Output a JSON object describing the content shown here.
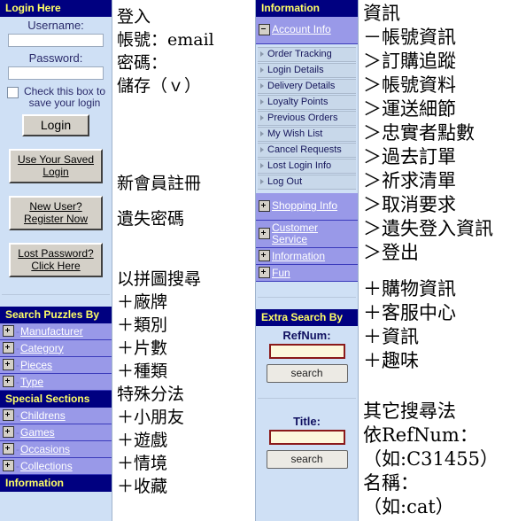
{
  "login_panel": {
    "header": "Login Here",
    "username_label": "Username:",
    "username_value": "",
    "password_label": "Password:",
    "password_value": "",
    "checkbox_label": "Check this box to save your login",
    "login_button": "Login",
    "saved_login_button": "Use Your Saved Login",
    "register_button": "New User? Register Now",
    "lost_password_button": "Lost Password? Click Here"
  },
  "search_puzzles": {
    "header": "Search Puzzles By",
    "items": [
      {
        "label": "Manufacturer",
        "icon": "plus-icon"
      },
      {
        "label": "Category",
        "icon": "plus-icon"
      },
      {
        "label": "Pieces",
        "icon": "plus-icon"
      },
      {
        "label": "Type",
        "icon": "plus-icon"
      }
    ]
  },
  "special_sections": {
    "header": "Special Sections",
    "items": [
      {
        "label": "Childrens",
        "icon": "plus-icon"
      },
      {
        "label": "Games",
        "icon": "plus-icon"
      },
      {
        "label": "Occasions",
        "icon": "plus-icon"
      },
      {
        "label": "Collections",
        "icon": "plus-icon"
      }
    ]
  },
  "information_bar": {
    "header": "Information"
  },
  "cn_left": {
    "lines_login": [
      "登入",
      "帳號：email",
      "密碼：",
      "儲存（ｖ）"
    ],
    "register": "新會員註冊",
    "lost_password": "遺失密碼",
    "lines_search": [
      "以拼圖搜尋",
      "＋廠牌",
      "＋類別",
      "＋片數",
      "＋種類"
    ],
    "lines_special": [
      "特殊分法",
      "＋小朋友",
      "＋遊戲",
      "＋情境",
      "＋收藏"
    ]
  },
  "info_panel": {
    "header": "Information",
    "account_info": {
      "label": "Account Info",
      "icon": "minus-icon"
    },
    "account_children": [
      "Order Tracking",
      "Login Details",
      "Delivery Details",
      "Loyalty Points",
      "Previous Orders",
      "My Wish List",
      "Cancel Requests",
      "Lost Login Info",
      "Log Out"
    ],
    "groups": [
      {
        "label": "Shopping Info",
        "icon": "plus-icon",
        "two_line": true
      },
      {
        "label": "Customer Service",
        "icon": "plus-icon",
        "two_line": true
      },
      {
        "label": "Information",
        "icon": "plus-icon",
        "two_line": false
      },
      {
        "label": "Fun",
        "icon": "plus-icon",
        "two_line": false
      }
    ]
  },
  "extra_search": {
    "header": "Extra Search By",
    "refnum_label": "RefNum:",
    "refnum_value": "",
    "refnum_button": "search",
    "title_label": "Title:",
    "title_value": "",
    "title_button": "search"
  },
  "cn_right": {
    "lines_info": [
      "資訊",
      "－帳號資訊",
      "＞訂購追蹤",
      "＞帳號資料",
      "＞運送細節",
      "＞忠實者點數",
      "＞過去訂單",
      "＞祈求清單",
      "＞取消要求",
      "＞遺失登入資訊",
      "＞登出"
    ],
    "lines_groups": [
      "＋購物資訊",
      "＋客服中心",
      "＋資訊",
      "＋趣味"
    ],
    "lines_extra": [
      "其它搜尋法",
      "依RefNum：",
      "（如:C31455）",
      "名稱：",
      "（如:cat）"
    ]
  },
  "colors": {
    "header_bg": "#000080",
    "header_fg": "#ffff66",
    "panel_bg": "#cfe0f5",
    "nav_bg": "#9999e8",
    "input_red_border": "#8b1a1a",
    "input_cream_bg": "#fdf8dc"
  }
}
